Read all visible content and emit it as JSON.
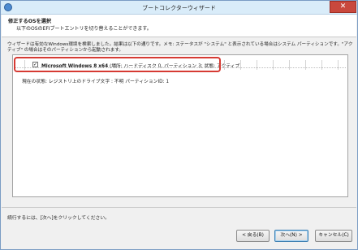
{
  "window": {
    "title": "ブートコレクターウィザード",
    "close_label": "✕"
  },
  "header": {
    "title": "修正するOSを選択",
    "subtitle": "以下のOSのEFIブートエントリを切り替えることができます。"
  },
  "description": "ウィザードは有効なWindows環境を検索しました。結果は以下の通りです。メモ: ステータスが \"システム\" と表示されている場合はシステム パーティションです。\"アクティブ\" の場合はそのパーティションから起動されます。",
  "os_list": {
    "items": [
      {
        "checked": true,
        "check_mark": "✓",
        "name": "Microsoft Windows 8 x64",
        "details": "(場所: ハードディスク 0, パーティション 3; 状態: アクティブ)"
      }
    ],
    "status_line": "現在の状態: レジストリ上のドライブ文字 : 不明 パーティションID: 1"
  },
  "footer": {
    "instruction": "続行するには、[次へ]をクリックしてください。"
  },
  "buttons": {
    "back": "< 戻る(B)",
    "next": "次へ(N) >",
    "cancel": "キャンセル(C)"
  },
  "colors": {
    "highlight": "#d63a33",
    "titlebar": "#d9ecf9",
    "close": "#c9483d"
  }
}
